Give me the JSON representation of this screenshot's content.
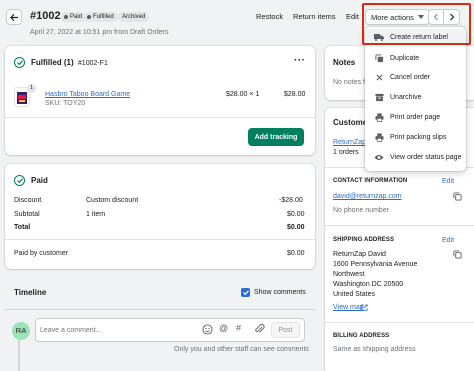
{
  "header": {
    "order_number": "#1002",
    "badges": {
      "paid": "Paid",
      "fulfilled": "Fulfilled",
      "archived": "Archived"
    },
    "subtitle": "April 27, 2022 at 10:51 pm from Draft Orders",
    "actions": {
      "restock": "Restock",
      "return_items": "Return items",
      "edit": "Edit",
      "more_actions": "More actions"
    }
  },
  "dropdown": {
    "items": [
      {
        "label": "Create return label",
        "icon": "truck-icon"
      },
      {
        "label": "Duplicate",
        "icon": "duplicate-icon"
      },
      {
        "label": "Cancel order",
        "icon": "close-icon"
      },
      {
        "label": "Unarchive",
        "icon": "unarchive-icon"
      },
      {
        "label": "Print order page",
        "icon": "print-icon"
      },
      {
        "label": "Print packing slips",
        "icon": "print-icon"
      },
      {
        "label": "View order status page",
        "icon": "eye-icon"
      }
    ]
  },
  "fulfilled_card": {
    "title": "Fulfilled (1)",
    "fulfillment_id": "#1002-F1",
    "item": {
      "qty_badge": "1",
      "name": "Hasbro Taboo Board Game",
      "sku": "SKU: TOY20",
      "price": "$28.00 × 1",
      "total": "$28.00"
    },
    "add_tracking": "Add tracking"
  },
  "paid_card": {
    "title": "Paid",
    "rows": [
      {
        "label": "Discount",
        "desc": "Custom discount",
        "amount": "-$28.00"
      },
      {
        "label": "Subtotal",
        "desc": "1 item",
        "amount": "$0.00"
      },
      {
        "label": "Total",
        "desc": "",
        "amount": "$0.00"
      }
    ],
    "paid_by_customer": {
      "label": "Paid by customer",
      "amount": "$0.00"
    }
  },
  "timeline": {
    "title": "Timeline",
    "show_comments": "Show comments",
    "avatar": "RA",
    "comment_placeholder": "Leave a comment...",
    "post": "Post",
    "note": "Only you and other staff can see comments"
  },
  "notes": {
    "title": "Notes",
    "text": "No notes fr"
  },
  "customer": {
    "title": "Customer",
    "name": "ReturnZap",
    "orders": "1 orders",
    "contact_title": "CONTACT INFORMATION",
    "edit": "Edit",
    "email": "david@returnzap.com",
    "phone": "No phone number",
    "shipping_title": "SHIPPING ADDRESS",
    "address": [
      "ReturnZap David",
      "1600 Pennsylvania Avenue",
      "Northwest",
      "Washington DC 20500",
      "United States"
    ],
    "view_map": "View map",
    "billing_title": "BILLING ADDRESS",
    "billing_text": "Same as shipping address"
  }
}
